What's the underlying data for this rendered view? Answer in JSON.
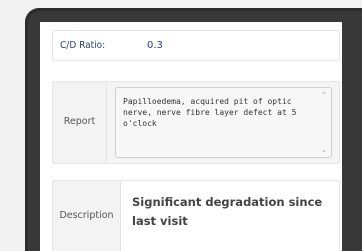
{
  "cd_ratio": {
    "label": "C/D Ratio:",
    "value": "0.3"
  },
  "report": {
    "label": "Report",
    "text": "Papilloedema, acquired pit of optic nerve, nerve fibre layer defect at 5 o'clock"
  },
  "description": {
    "label": "Description",
    "value": "Significant degradation since last visit"
  },
  "icons": [
    "scroll-up-arrow-icon",
    "scroll-down-arrow-icon"
  ]
}
